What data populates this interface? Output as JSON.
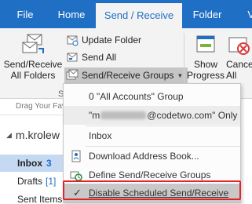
{
  "tabs": {
    "file": "File",
    "home": "Home",
    "send_receive": "Send / Receive",
    "folder": "Folder",
    "view": "Vi"
  },
  "ribbon": {
    "send_receive_all_line1": "Send/Receive",
    "send_receive_all_line2": "All Folders",
    "update_folder": "Update Folder",
    "send_all": "Send All",
    "send_receive_groups": "Send/Receive Groups",
    "group_label_partial": "S",
    "show_progress_line1": "Show",
    "show_progress_line2": "Progress",
    "cancel_all_line1": "Cancel",
    "cancel_all_line2": "All"
  },
  "folder_pane": {
    "drag_hint": "Drag Your Favori",
    "account": "m.krolew",
    "folders": [
      {
        "name": "Inbox",
        "count": "3"
      },
      {
        "name": "Drafts",
        "count": "[1]"
      },
      {
        "name": "Sent Items",
        "count": ""
      }
    ]
  },
  "menu": {
    "item_all_accounts": "0 \"All Accounts\" Group",
    "item_only_prefix": "\"m",
    "item_only_suffix": "@codetwo.com\" Only",
    "item_inbox": "Inbox",
    "item_download_address_book": "Download Address Book...",
    "item_define_groups": "Define Send/Receive Groups",
    "item_disable_scheduled": "Disable Scheduled Send/Receive",
    "checkmark": "✓"
  },
  "colors": {
    "ribbon_blue": "#1f6fc5",
    "highlight_red": "#e3232a",
    "selection_blue": "#c5daf2"
  }
}
